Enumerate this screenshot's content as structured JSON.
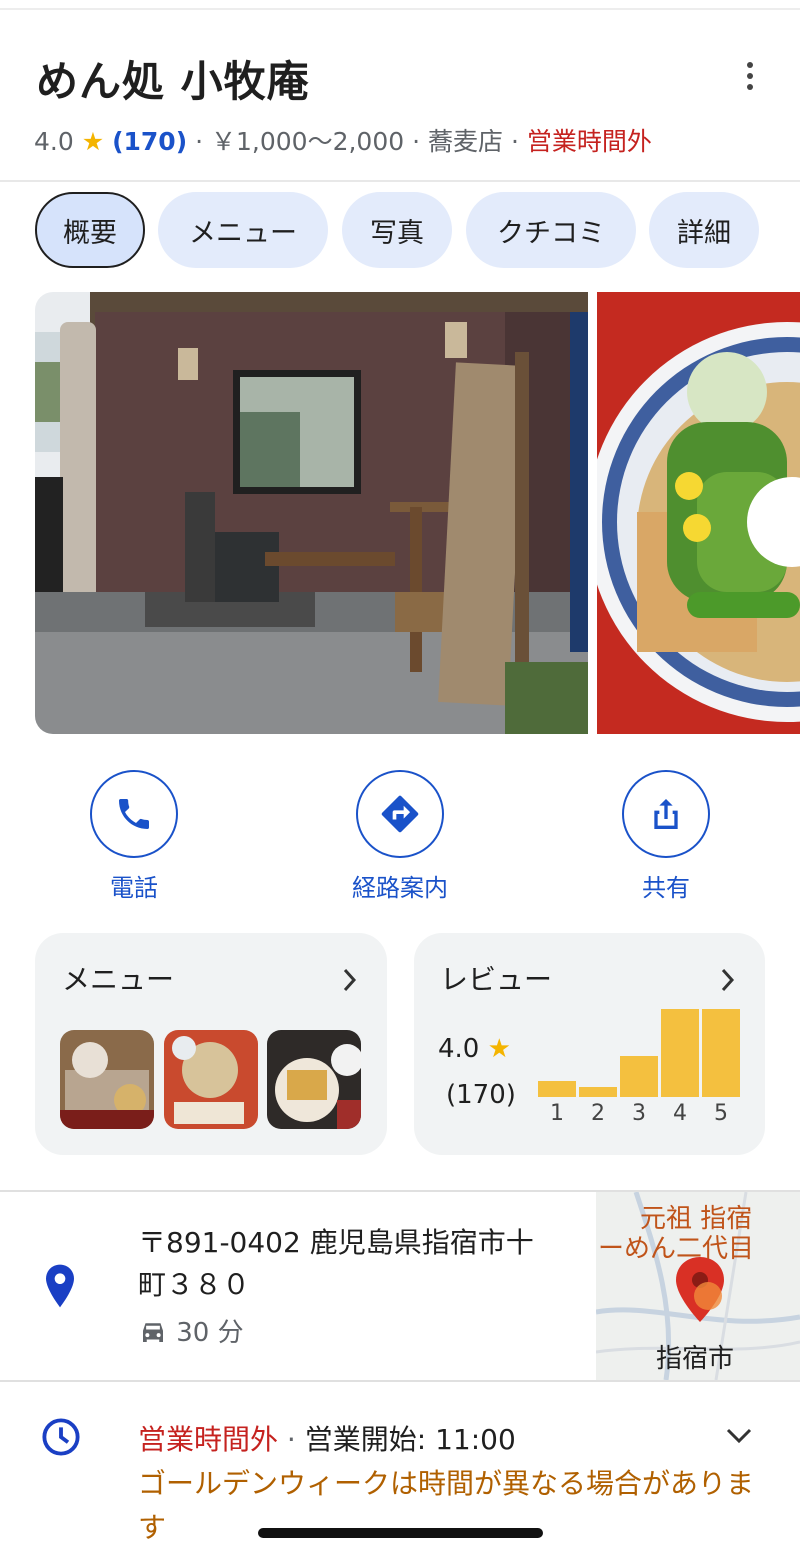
{
  "place": {
    "name": "めん処 小牧庵",
    "rating": "4.0",
    "rating_star": "★",
    "review_count": "(170)",
    "dot": "·",
    "price": "￥1,000〜2,000",
    "category": "蕎麦店",
    "status": "営業時間外"
  },
  "tabs": [
    "概要",
    "メニュー",
    "写真",
    "クチコミ",
    "詳細"
  ],
  "actions": {
    "call": "電話",
    "directions": "経路案内",
    "share": "共有"
  },
  "menu_card": {
    "title": "メニュー"
  },
  "review_card": {
    "title": "レビュー",
    "rating": "4.0",
    "star": "★",
    "count": "(170)",
    "labels": [
      "1",
      "2",
      "3",
      "4",
      "5"
    ],
    "distribution": [
      0.2,
      0.13,
      0.48,
      1.0,
      1.0
    ]
  },
  "address": {
    "text": "〒891-0402 鹿児島県指宿市十町３８０",
    "drive_time": "30 分"
  },
  "map": {
    "label_top": "元祖 指宿",
    "label_top2": "ーめん二代目",
    "label_city": "指宿市"
  },
  "hours": {
    "status": "営業時間外",
    "dot": "·",
    "opens": "営業開始: 11:00",
    "note": "ゴールデンウィークは時間が異なる場合があります"
  },
  "colors": {
    "accent": "#1a52c9",
    "closed": "#c5221f",
    "star": "#f4b400",
    "bar": "#f4c03f",
    "note": "#b06000"
  }
}
